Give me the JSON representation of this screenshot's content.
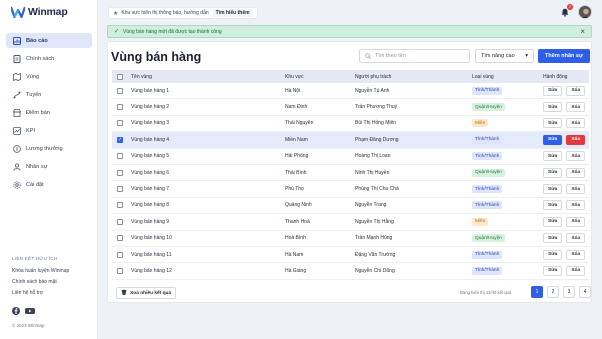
{
  "app": {
    "name": "Winmap"
  },
  "colors": {
    "accent": "#2f5fe6",
    "danger": "#e23b3b",
    "success_bg": "#cfeedb"
  },
  "sidebar": {
    "items": [
      {
        "label": "Báo cáo",
        "icon": "report-icon",
        "active": true
      },
      {
        "label": "Chính sách",
        "icon": "policy-icon"
      },
      {
        "label": "Vùng",
        "icon": "region-icon"
      },
      {
        "label": "Tuyến",
        "icon": "route-icon"
      },
      {
        "label": "Điểm bán",
        "icon": "store-icon"
      },
      {
        "label": "KPI",
        "icon": "kpi-icon"
      },
      {
        "label": "Lương thưởng",
        "icon": "salary-icon"
      },
      {
        "label": "Nhân sự",
        "icon": "people-icon"
      },
      {
        "label": "Cài đặt",
        "icon": "gear-icon"
      }
    ],
    "links_title": "LIÊN KẾT HỮU ÍCH",
    "links": [
      "Khóa huấn luyện Winmap",
      "Chính sách bảo mật",
      "Liên hệ hỗ trợ"
    ],
    "copyright": "© 2023 Winmap"
  },
  "topbar": {
    "notice_text": "Khu vực hiển thị thông báo, hướng dẫn",
    "notice_more": "Tìm hiểu thêm",
    "notification_count": "2"
  },
  "toast": {
    "message": "Vùng bán hàng mới đã được tạo thành công"
  },
  "main": {
    "title": "Vùng bán hàng",
    "search_placeholder": "Tìm theo tên",
    "advanced_label": "Tìm nâng cao",
    "add_label": "Thêm nhân sự"
  },
  "table": {
    "headers": {
      "name": "Tên vùng",
      "area": "Khu vực",
      "person": "Người phụ trách",
      "type": "Loại vùng",
      "action": "Hành động"
    },
    "edit_label": "Sửa",
    "delete_label": "Xóa",
    "rows": [
      {
        "name": "Vùng bán hàng 1",
        "area": "Hà Nội",
        "person": "Nguyễn Tú Anh",
        "type": "Tỉnh/Thành",
        "kind": "tinh"
      },
      {
        "name": "Vùng bán hàng 2",
        "area": "Nam Định",
        "person": "Trần Phương Thuý",
        "type": "Quận/Huyện",
        "kind": "quan"
      },
      {
        "name": "Vùng bán hàng 3",
        "area": "Thái Nguyên",
        "person": "Bùi Thị Hồng Miên",
        "type": "Miền",
        "kind": "mien"
      },
      {
        "name": "Vùng bán hàng 4",
        "area": "Miền Nam",
        "person": "Phạm Đăng Dương",
        "type": "Tỉnh/Thành",
        "kind": "tinh",
        "selected": true
      },
      {
        "name": "Vùng bán hàng 5",
        "area": "Hải Phòng",
        "person": "Hoàng Thị Loan",
        "type": "Tỉnh/Thành",
        "kind": "tinh"
      },
      {
        "name": "Vùng bán hàng 6",
        "area": "Thái Bình",
        "person": "Ninh Thị Huyền",
        "type": "Quận/Huyện",
        "kind": "quan"
      },
      {
        "name": "Vùng bán hàng 7",
        "area": "Phú Thọ",
        "person": "Phùng Thị Chu Chả",
        "type": "Tỉnh/Thành",
        "kind": "tinh"
      },
      {
        "name": "Vùng bán hàng 8",
        "area": "Quảng Ninh",
        "person": "Nguyễn Trang",
        "type": "Tỉnh/Thành",
        "kind": "tinh"
      },
      {
        "name": "Vùng bán hàng 9",
        "area": "Thanh Hoá",
        "person": "Nguyễn Thị Hằng",
        "type": "Miền",
        "kind": "mien"
      },
      {
        "name": "Vùng bán hàng 10",
        "area": "Hoà Bình",
        "person": "Trần Mạnh Hùng",
        "type": "Quận/Huyện",
        "kind": "quan"
      },
      {
        "name": "Vùng bán hàng 11",
        "area": "Hà Nam",
        "person": "Đặng Văn Trường",
        "type": "Tỉnh/Thành",
        "kind": "tinh"
      },
      {
        "name": "Vùng bán hàng 12",
        "area": "Hà Giang",
        "person": "Nguyễn Chí Dũng",
        "type": "Tỉnh/Thành",
        "kind": "tinh"
      }
    ]
  },
  "footer": {
    "bulk_delete": "Xoá nhiều kết quả",
    "page_info": "Đang hiển thị 12/40 kết quả",
    "pages": [
      "1",
      "2",
      "3",
      "4"
    ],
    "current_page": "1"
  }
}
